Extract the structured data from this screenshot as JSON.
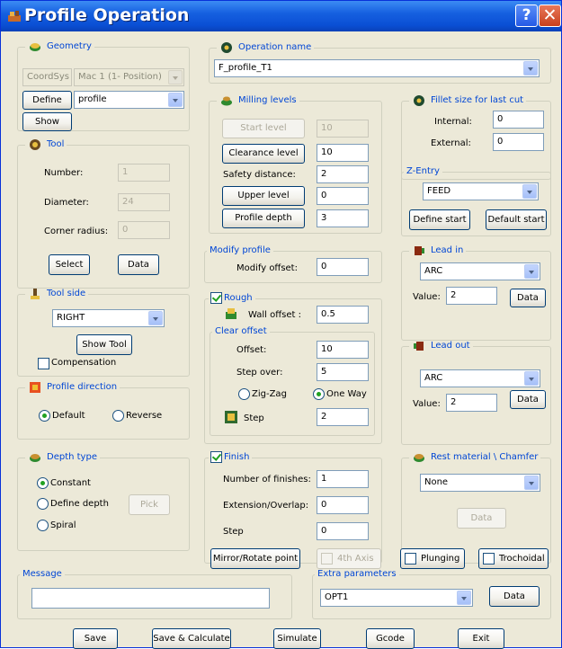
{
  "window": {
    "title": "Profile Operation",
    "help": "?",
    "close": "✕"
  },
  "geometry": {
    "title": "Geometry",
    "coordsys": "CoordSys",
    "mac": "Mac 1 (1- Position)",
    "define_btn": "Define",
    "profile": "profile",
    "show_btn": "Show"
  },
  "tool": {
    "title": "Tool",
    "number_label": "Number:",
    "number": "1",
    "diameter_label": "Diameter:",
    "diameter": "24",
    "corner_label": "Corner radius:",
    "corner": "0",
    "select_btn": "Select",
    "data_btn": "Data"
  },
  "tool_side": {
    "title": "Tool side",
    "value": "RIGHT",
    "show_tool_btn": "Show Tool",
    "compensation": "Compensation"
  },
  "profile_direction": {
    "title": "Profile direction",
    "default": "Default",
    "reverse": "Reverse"
  },
  "depth_type": {
    "title": "Depth type",
    "constant": "Constant",
    "define_depth": "Define depth",
    "pick_btn": "Pick",
    "spiral": "Spiral"
  },
  "operation_name": {
    "title": "Operation name",
    "value": "F_profile_T1"
  },
  "milling_levels": {
    "title": "Milling levels",
    "start_btn": "Start level",
    "start": "10",
    "clearance_btn": "Clearance level",
    "clearance": "10",
    "safety_label": "Safety distance:",
    "safety": "2",
    "upper_btn": "Upper level",
    "upper": "0",
    "depth_btn": "Profile depth",
    "depth": "3"
  },
  "modify_profile": {
    "title": "Modify profile",
    "offset_label": "Modify offset:",
    "offset": "0"
  },
  "rough": {
    "title": "Rough",
    "wall_label": "Wall offset :",
    "wall": "0.5",
    "clear_title": "Clear offset",
    "offset_label": "Offset:",
    "offset": "10",
    "stepover_label": "Step over:",
    "stepover": "5",
    "zigzag": "Zig-Zag",
    "oneway": "One Way",
    "step_label": "Step",
    "step": "2"
  },
  "finish": {
    "title": "Finish",
    "num_label": "Number of finishes:",
    "num": "1",
    "ext_label": "Extension/Overlap:",
    "ext": "0",
    "step_label": "Step",
    "step": "0"
  },
  "fillet": {
    "title": "Fillet size for last cut",
    "internal_label": "Internal:",
    "internal": "0",
    "external_label": "External:",
    "external": "0"
  },
  "zentry": {
    "title": "Z-Entry",
    "value": "FEED",
    "define_start_btn": "Define start",
    "default_start_btn": "Default start"
  },
  "lead_in": {
    "title": "Lead in",
    "value": "ARC",
    "value_label": "Value:",
    "amount": "2",
    "data_btn": "Data"
  },
  "lead_out": {
    "title": "Lead out",
    "value": "ARC",
    "value_label": "Value:",
    "amount": "2",
    "data_btn": "Data"
  },
  "rest": {
    "title": "Rest material \\ Chamfer",
    "value": "None",
    "data_btn": "Data"
  },
  "options": {
    "mirror_btn": "Mirror/Rotate point",
    "axis4": "4th Axis",
    "plunging": "Plunging",
    "trochoidal": "Trochoidal"
  },
  "message": {
    "title": "Message",
    "value": ""
  },
  "extra": {
    "title": "Extra parameters",
    "value": "OPT1",
    "data_btn": "Data"
  },
  "footer": {
    "save": "Save",
    "save_calc": "Save & Calculate",
    "simulate": "Simulate",
    "gcode": "Gcode",
    "exit": "Exit"
  }
}
